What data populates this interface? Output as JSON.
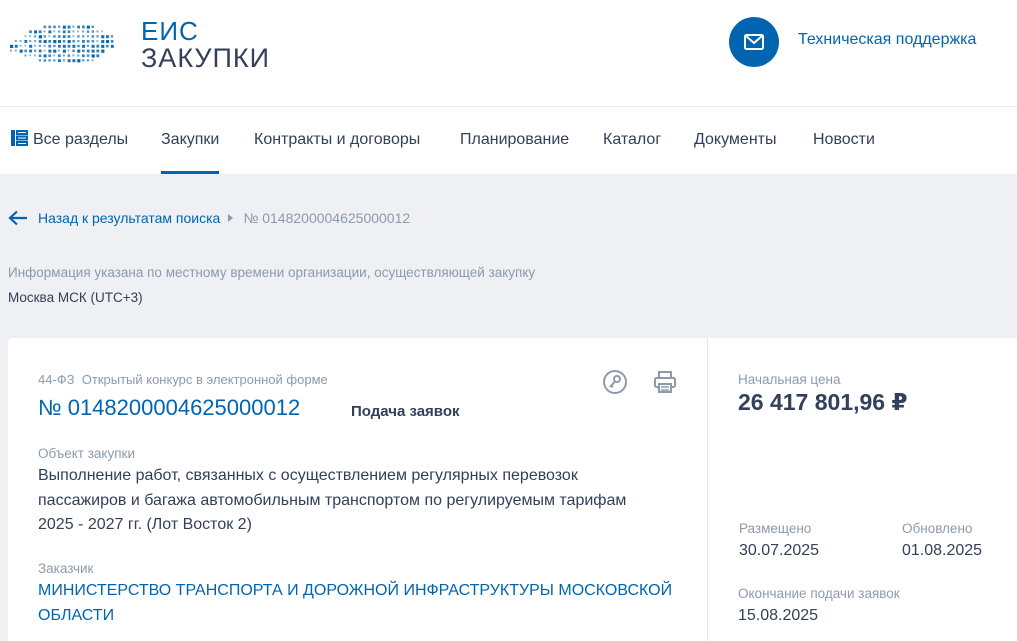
{
  "header": {
    "logo_line1": "ЕИС",
    "logo_line2": "ЗАКУПКИ",
    "support_label": "Техническая поддержка",
    "support_icon": "envelope-icon",
    "accent_color": "#0065b1"
  },
  "nav": {
    "all_sections": "Все разделы",
    "items": [
      "Закупки",
      "Контракты и договоры",
      "Планирование",
      "Каталог",
      "Документы",
      "Новости"
    ],
    "active": "Закупки"
  },
  "breadcrumb": {
    "back_label": "Назад к результатам поиска",
    "current": "№ 0148200004625000012"
  },
  "timezone": {
    "info": "Информация указана по местному времени организации, осуществляющей закупку",
    "value": "Москва МСК (UTC+3)"
  },
  "procurement": {
    "type": "44-ФЗ  Открытый конкурс в электронной форме",
    "number": "№ 0148200004625000012",
    "stage": "Подача заявок",
    "object_label": "Объект закупки",
    "object_lines": [
      "Выполнение работ, связанных с осуществлением регулярных перевозок",
      "пассажиров и багажа автомобильным транспортом по регулируемым тарифам",
      "2025 - 2027 гг. (Лот Восток 2)"
    ],
    "customer_label": "Заказчик",
    "customer_lines": [
      "МИНИСТЕРСТВО ТРАНСПОРТА И ДОРОЖНОЙ ИНФРАСТРУКТУРЫ МОСКОВСКОЙ",
      "ОБЛАСТИ"
    ]
  },
  "summary": {
    "price_label": "Начальная цена",
    "price_value": "26 417 801,96 ₽",
    "posted_label": "Размещено",
    "posted_value": "30.07.2025",
    "updated_label": "Обновлено",
    "updated_value": "01.08.2025",
    "deadline_label": "Окончание подачи заявок",
    "deadline_value": "15.08.2025"
  }
}
